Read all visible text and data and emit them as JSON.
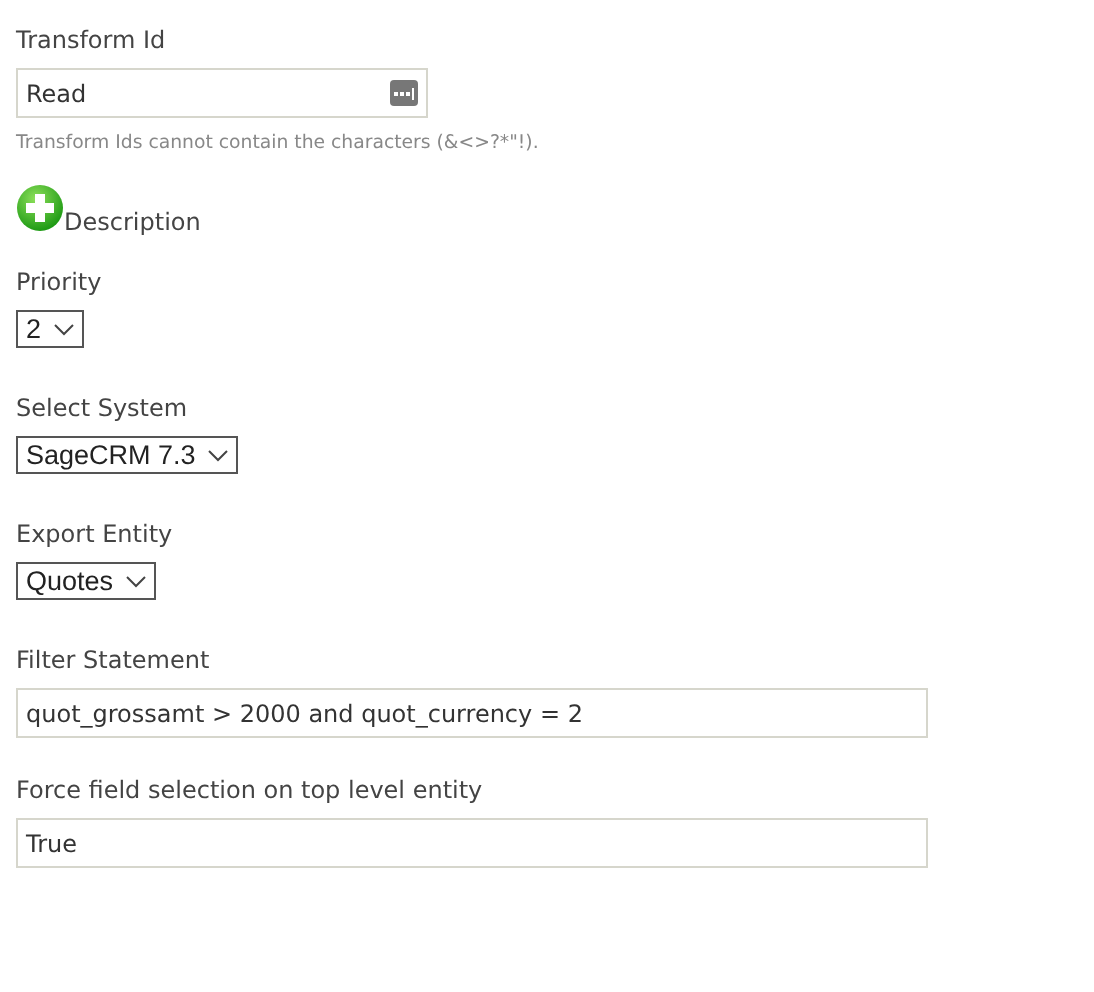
{
  "fields": [
    {
      "kind": "text",
      "label": "Transform Id",
      "value": "Read",
      "has_lookup": true,
      "hint": "Transform Ids cannot contain the characters (&<>?*\"!)."
    },
    {
      "kind": "add",
      "label": "Description"
    },
    {
      "kind": "select",
      "label": "Priority",
      "value": "2"
    },
    {
      "kind": "select",
      "label": "Select System",
      "value": "SageCRM 7.3"
    },
    {
      "kind": "select",
      "label": "Export Entity",
      "value": "Quotes"
    },
    {
      "kind": "text",
      "label": "Filter Statement",
      "value": "quot_grossamt > 2000 and quot_currency = 2",
      "has_lookup": false
    },
    {
      "kind": "text",
      "label": "Force field selection on top level entity",
      "value": "True",
      "has_lookup": false
    }
  ]
}
